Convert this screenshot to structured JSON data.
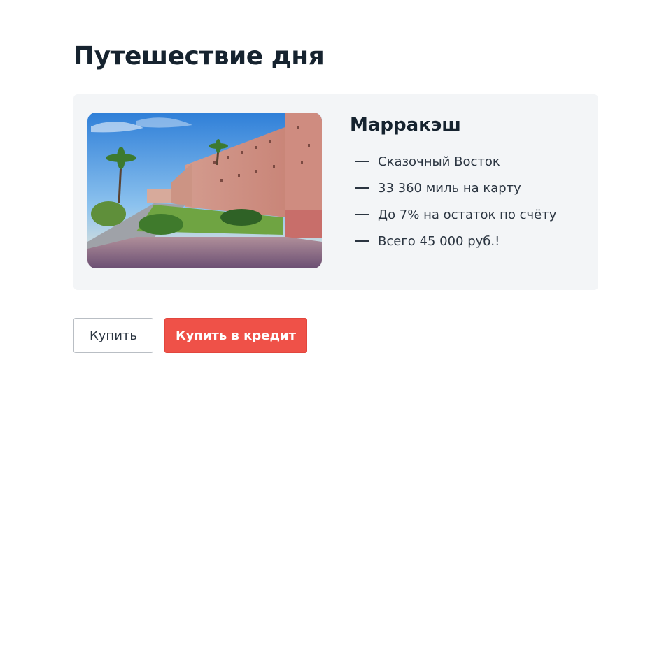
{
  "page": {
    "title": "Путешествие дня"
  },
  "offer": {
    "image": {
      "alt": "Марракэш",
      "scene": "city-wall-with-palms"
    },
    "city": "Марракэш",
    "features": [
      "Сказочный Восток",
      "33 360 миль на карту",
      "До 7% на остаток по счёту",
      "Всего 45 000 руб.!"
    ]
  },
  "actions": {
    "buy_label": "Купить",
    "credit_label": "Купить в кредит"
  },
  "colors": {
    "accent": "#ef5148",
    "card_background": "#f3f5f7",
    "text": "#16232f"
  }
}
